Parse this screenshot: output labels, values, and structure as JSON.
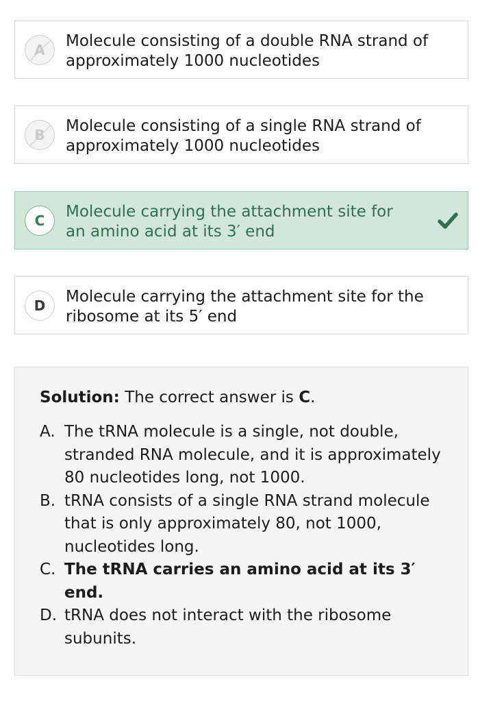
{
  "options": [
    {
      "letter": "A",
      "text": "Molecule consisting of a double RNA strand of\napproximately 1000 nucleotides",
      "state": "struck"
    },
    {
      "letter": "B",
      "text": "Molecule consisting of a single RNA strand of\napproximately 1000 nucleotides",
      "state": "struck"
    },
    {
      "letter": "C",
      "text": "Molecule carrying the attachment site for\nan amino acid at its 3′ end",
      "state": "correct"
    },
    {
      "letter": "D",
      "text": "Molecule carrying the attachment site for the\nribosome at its 5′ end",
      "state": "normal"
    }
  ],
  "solution": {
    "label": "Solution:",
    "intro": " The correct answer is ",
    "answer": "C",
    "end": ".",
    "explanations": [
      {
        "marker": "A.",
        "text": "The tRNA molecule is a single, not double, stranded RNA molecule, and it is approximately 80 nucleotides long, not 1000."
      },
      {
        "marker": "B.",
        "text": "tRNA consists of a single RNA strand molecule that is only approximately 80, not 1000, nucleotides long."
      },
      {
        "marker": "C.",
        "text": "The tRNA carries an amino acid at its 3′ end."
      },
      {
        "marker": "D.",
        "text": "tRNA does not interact with the ribosome subunits."
      }
    ]
  },
  "icons": {
    "correct_check": "checkmark-icon"
  },
  "colors": {
    "correct_bg": "#d3e6de",
    "correct_text": "#2e7050",
    "check": "#2e7050",
    "solution_bg": "#f5f5f5"
  }
}
